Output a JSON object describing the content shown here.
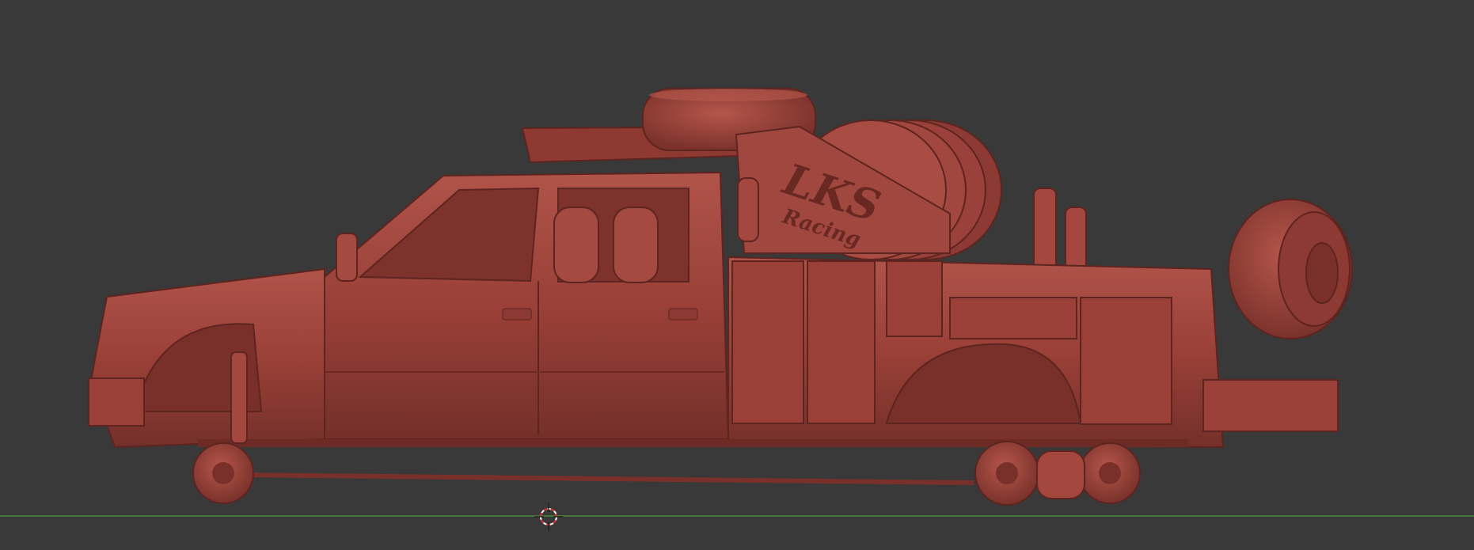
{
  "viewport": {
    "background": "#393939",
    "ground_axis_color": "#4b8a3a",
    "model_color": "#9a4038",
    "model_shadow": "#6e2a24",
    "model_highlight": "#b9574c"
  },
  "model": {
    "decal_line1": "LKS",
    "decal_line2": "Racing"
  },
  "icons": {
    "cursor": "3d-cursor-icon"
  }
}
